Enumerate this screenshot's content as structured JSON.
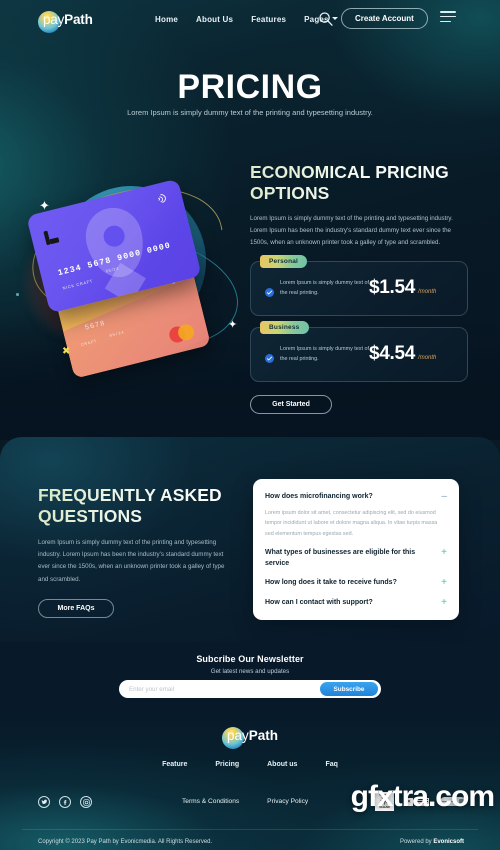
{
  "nav": {
    "logo": {
      "pre": "pay",
      "post": "Path"
    },
    "links": [
      {
        "label": "Home"
      },
      {
        "label": "About Us"
      },
      {
        "label": "Features"
      },
      {
        "label": "Pages"
      }
    ],
    "search_icon": "search-icon",
    "cta_label": "Create Account",
    "menu_icon": "hamburger-menu-icon"
  },
  "hero": {
    "title": "PRICING",
    "subtitle": "Lorem Ipsum is simply dummy text of the printing and typesetting industry."
  },
  "illustration": {
    "purple_card": {
      "number": "1234 5678 9000 0000",
      "name": "NICK CRAFT",
      "expiry": "05/24"
    },
    "orange_card": {
      "number": "5678",
      "name": "CRAFT",
      "expiry": "05/24"
    }
  },
  "pricing": {
    "title": "ECONOMICAL PRICING OPTIONS",
    "body": "Lorem Ipsum is simply dummy text of the printing and typesetting industry. Lorem Ipsum has been the industry's standard dummy text ever since the 1500s, when an unknown printer took a galley of type and scrambled.",
    "plans": [
      {
        "badge": "Personal",
        "description": "Lorem Ipsum is simply dummy text of the real printing.",
        "price": "$1.54",
        "period": "/month"
      },
      {
        "badge": "Business",
        "description": "Lorem Ipsum is simply dummy text of the real printing.",
        "price": "$4.54",
        "period": "/month"
      }
    ],
    "cta_label": "Get Started"
  },
  "faq": {
    "title": "FREQUENTLY ASKED QUESTIONS",
    "body": "Lorem Ipsum is simply dummy text of the printing and typesetting industry. Lorem Ipsum has been the industry's standard dummy text ever since the 1500s, when an unknown printer took a galley of type and scrambled.",
    "cta_label": "More FAQs",
    "items": [
      {
        "question": "How does microfinancing work?",
        "answer": "Lorem ipsum dolor sit amet, consectetur adipiscing elit, sed do eiusmod tempor incididunt ut labore et dolore magna aliqua. In vitae turpis massa sed elementum tempus egestas sed.",
        "sign": "–",
        "open": true
      },
      {
        "question": "What types of businesses are eligible for this service",
        "answer": "",
        "sign": "+",
        "open": false
      },
      {
        "question": "How long does it take to receive funds?",
        "answer": "",
        "sign": "+",
        "open": false
      },
      {
        "question": "How can I contact with support?",
        "answer": "",
        "sign": "+",
        "open": false
      }
    ]
  },
  "newsletter": {
    "title": "Subcribe Our Newsletter",
    "subtitle": "Get latest news and updates",
    "placeholder": "Enter your email",
    "value": "",
    "button_label": "Subscribe"
  },
  "footer": {
    "logo": {
      "pre": "pay",
      "post": "Path"
    },
    "links": [
      {
        "label": "Feature"
      },
      {
        "label": "Pricing"
      },
      {
        "label": "About us"
      },
      {
        "label": "Faq"
      }
    ],
    "socials": [
      {
        "name": "twitter-icon",
        "glyph": "⟳"
      },
      {
        "name": "facebook-icon",
        "glyph": "f"
      },
      {
        "name": "instagram-icon",
        "glyph": "◎"
      }
    ],
    "legal": [
      {
        "label": "Terms & Conditions"
      },
      {
        "label": "Privacy Policy"
      }
    ],
    "badges": [
      {
        "name": "ultra-clear-badge",
        "top": "ULTRA",
        "bottom": "CLEAR"
      },
      {
        "name": "certification-badge"
      },
      {
        "name": "payment-pill-badge"
      }
    ],
    "copyright": "Copyright © 2023 Pay Path by Evonicmedia. All Rights Reserved.",
    "powered_prefix": "Powered by ",
    "powered_brand": "Evonicsoft"
  },
  "watermark": {
    "text": "gfxtra.com"
  },
  "colors": {
    "accent_green": "#4fc3a8",
    "accent_blue": "#2183d8",
    "badge_gradient_start": "#e7c463",
    "badge_gradient_end": "#6fc3a8",
    "price_period": "#d9a15f",
    "card_purple": "#6450ee",
    "card_orange": "#f3b459"
  }
}
